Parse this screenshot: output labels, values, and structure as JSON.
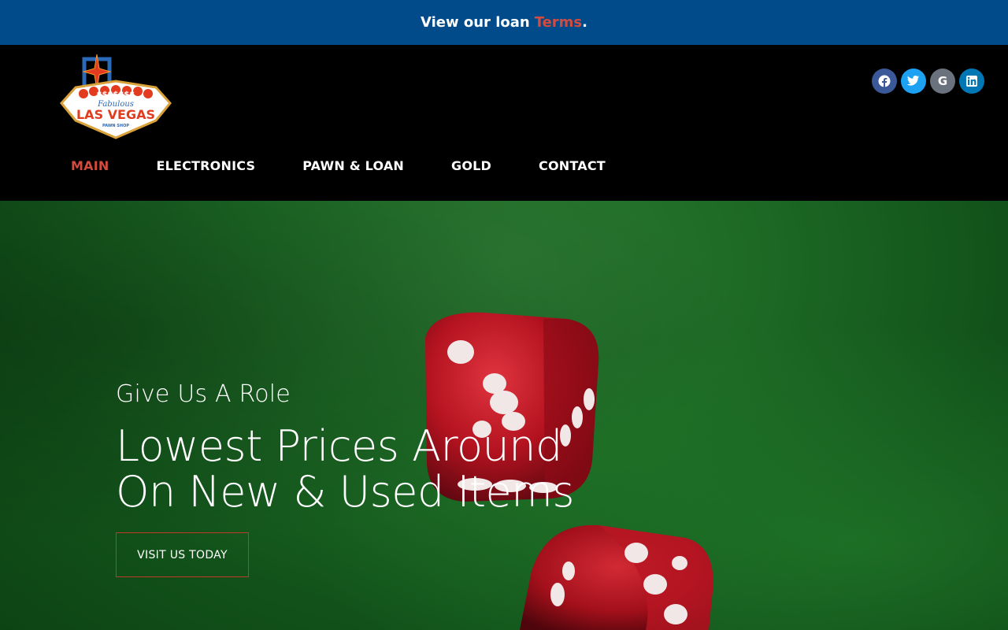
{
  "topbar": {
    "text": "View our loan",
    "link": "Terms",
    "period": "."
  },
  "logo": {
    "line1": "Fabulous",
    "line2": "LAS VEGAS",
    "line3": "PAWN SHOP",
    "dollars": "$$$$$$$"
  },
  "social": {
    "facebook": "f",
    "twitter": "t",
    "google": "G",
    "linkedin": "in"
  },
  "nav": {
    "items": [
      {
        "label": "MAIN"
      },
      {
        "label": "ELECTRONICS"
      },
      {
        "label": "PAWN & LOAN"
      },
      {
        "label": "GOLD"
      },
      {
        "label": "CONTACT"
      }
    ]
  },
  "hero": {
    "subtitle": "Give Us A Role",
    "headline_line1": "Lowest Prices Around",
    "headline_line2": "On New & Used Items",
    "cta": "VISIT US TODAY"
  },
  "colors": {
    "topbar": "#024b8b",
    "accent": "#d24b3e",
    "nav_bg": "#000000",
    "felt": "#1d6a25"
  }
}
